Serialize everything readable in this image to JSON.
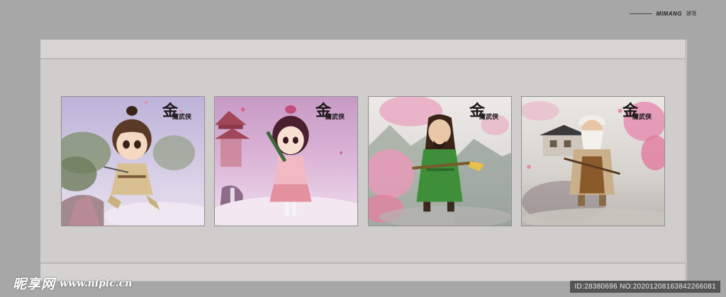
{
  "brand": {
    "name": "MIMANG",
    "sub": "迷氓"
  },
  "panels": [
    {
      "calligraphy_big": "金",
      "calligraphy_small": "庸武侠",
      "character": "young-swordsman"
    },
    {
      "calligraphy_big": "金",
      "calligraphy_small": "庸武侠",
      "character": "girl-with-flute"
    },
    {
      "calligraphy_big": "金",
      "calligraphy_small": "庸武侠",
      "character": "green-robed-swordsman"
    },
    {
      "calligraphy_big": "金",
      "calligraphy_small": "庸武侠",
      "character": "old-master-with-staff"
    }
  ],
  "watermark": {
    "logo": "昵享网",
    "url": "www.nipic.cn"
  },
  "meta": {
    "text": "ID:28380696 NO:20201208163842266081"
  },
  "colors": {
    "background": "#a7a7a7",
    "wall": "#cfcecd",
    "blossom": "#e58fb0",
    "mist": "#c9b8d6"
  }
}
